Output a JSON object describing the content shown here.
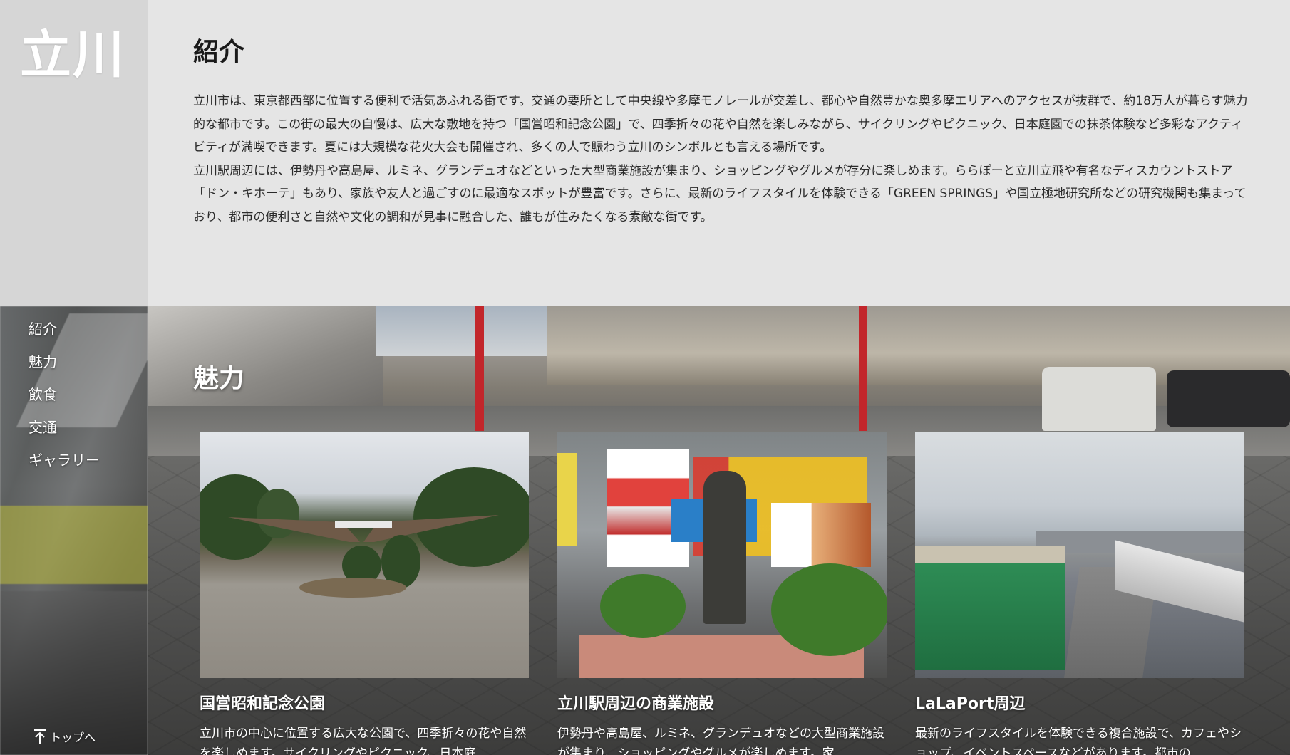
{
  "site": {
    "logo": "立川"
  },
  "nav": {
    "items": [
      "紹介",
      "魅力",
      "飲食",
      "交通",
      "ギャラリー"
    ],
    "to_top": "トップへ"
  },
  "intro": {
    "title": "紹介",
    "paragraph1": "立川市は、東京都西部に位置する便利で活気あふれる街です。交通の要所として中央線や多摩モノレールが交差し、都心や自然豊かな奥多摩エリアへのアクセスが抜群で、約18万人が暮らす魅力的な都市です。この街の最大の自慢は、広大な敷地を持つ「国営昭和記念公園」で、四季折々の花や自然を楽しみながら、サイクリングやピクニック、日本庭園での抹茶体験など多彩なアクティビティが満喫できます。夏には大規模な花火大会も開催され、多くの人で賑わう立川のシンボルとも言える場所です。",
    "paragraph2": "立川駅周辺には、伊勢丹や高島屋、ルミネ、グランデュオなどといった大型商業施設が集まり、ショッピングやグルメが存分に楽しめます。ららぽーと立川立飛や有名なディスカウントストア「ドン・キホーテ」もあり、家族や友人と過ごすのに最適なスポットが豊富です。さらに、最新のライフスタイルを体験できる「GREEN SPRINGS」や国立極地研究所などの研究機関も集まっており、都市の便利さと自然や文化の調和が見事に融合した、誰もが住みたくなる素敵な街です。"
  },
  "charm": {
    "title": "魅力",
    "cards": [
      {
        "title": "国営昭和記念公園",
        "desc": "立川市の中心に位置する広大な公園で、四季折々の花や自然を楽しめます。サイクリングやピクニック、日本庭"
      },
      {
        "title": "立川駅周辺の商業施設",
        "desc": "伊勢丹や高島屋、ルミネ、グランデュオなどの大型商業施設が集まり、ショッピングやグルメが楽しめます。家"
      },
      {
        "title": "LaLaPort周辺",
        "desc": "最新のライフスタイルを体験できる複合施設で、カフェやショップ、イベントスペースなどがあります。都市の"
      }
    ]
  },
  "colors": {
    "background": "#e5e5e5",
    "sidebar": "#d6d6d6",
    "text": "#2a2a2a",
    "accent_red": "#c2262b"
  }
}
